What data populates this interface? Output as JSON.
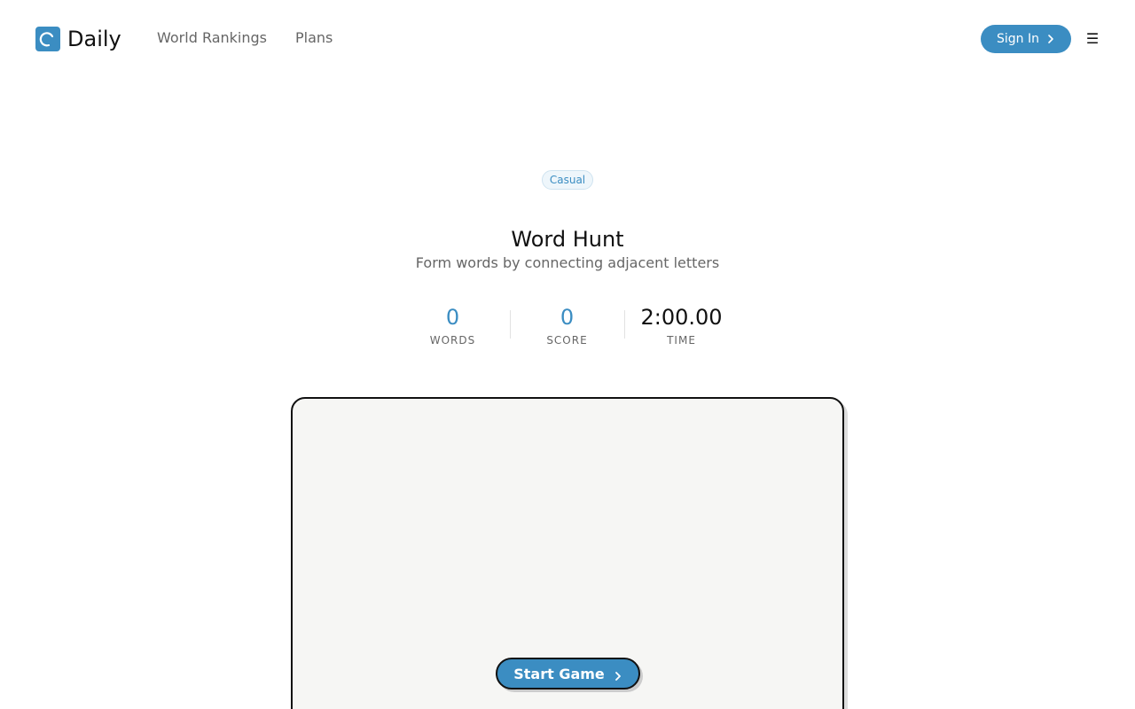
{
  "header": {
    "brand": "Daily",
    "nav": [
      {
        "label": "World Rankings"
      },
      {
        "label": "Plans"
      }
    ],
    "signin_label": "Sign In",
    "menu_glyph": "☰"
  },
  "game": {
    "badge": "Casual",
    "title": "Word Hunt",
    "subtitle": "Form words by connecting adjacent letters",
    "stats": {
      "words": {
        "value": "0",
        "label": "WORDS"
      },
      "score": {
        "value": "0",
        "label": "SCORE"
      },
      "time": {
        "value": "2:00.00",
        "label": "TIME"
      }
    },
    "start_label": "Start Game"
  },
  "colors": {
    "accent": "#3b8dc2",
    "board_bg": "#f6f6f4",
    "text_muted": "#666666"
  }
}
